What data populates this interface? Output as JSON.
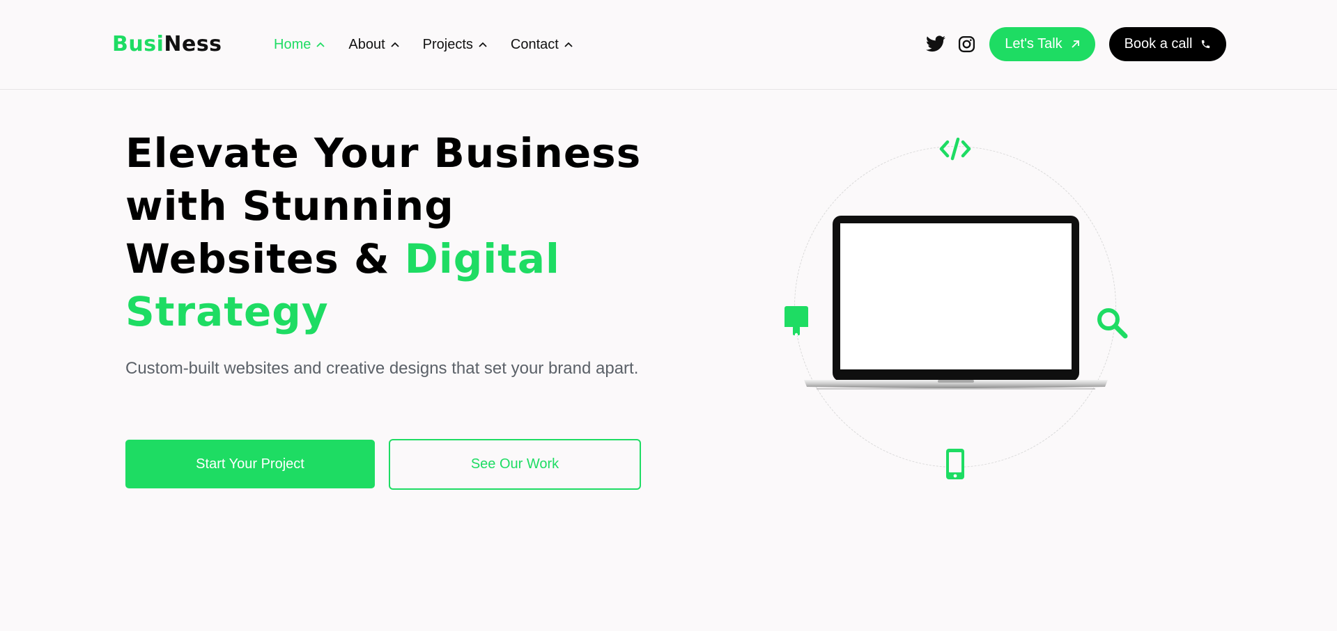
{
  "brand": {
    "part1": "Busi",
    "part2": "Ness"
  },
  "nav": {
    "items": [
      {
        "label": "Home"
      },
      {
        "label": "About"
      },
      {
        "label": "Projects"
      },
      {
        "label": "Contact"
      }
    ]
  },
  "header_actions": {
    "talk_label": "Let's Talk",
    "call_label": "Book a call"
  },
  "hero": {
    "title_line1": "Elevate Your Business",
    "title_line2": "with Stunning",
    "title_line3_black": "Websites & ",
    "title_line3_green": "Digital",
    "title_line4": "Strategy",
    "subtitle": "Custom-built websites and creative designs that set your brand apart.",
    "primary_cta": "Start Your Project",
    "secondary_cta": "See Our Work"
  },
  "icons": {
    "nav_chevron": "chevron-up-icon",
    "twitter": "twitter-icon",
    "instagram": "instagram-icon",
    "talk": "arrow-up-right-icon",
    "call": "phone-icon",
    "code": "code-icon",
    "paint": "paint-roller-icon",
    "search": "search-icon",
    "mobile": "mobile-phone-icon",
    "laptop": "laptop-icon"
  },
  "colors": {
    "accent": "#1edc63",
    "dark": "#000000",
    "muted": "#5b6168",
    "background": "#fbf9fa"
  }
}
